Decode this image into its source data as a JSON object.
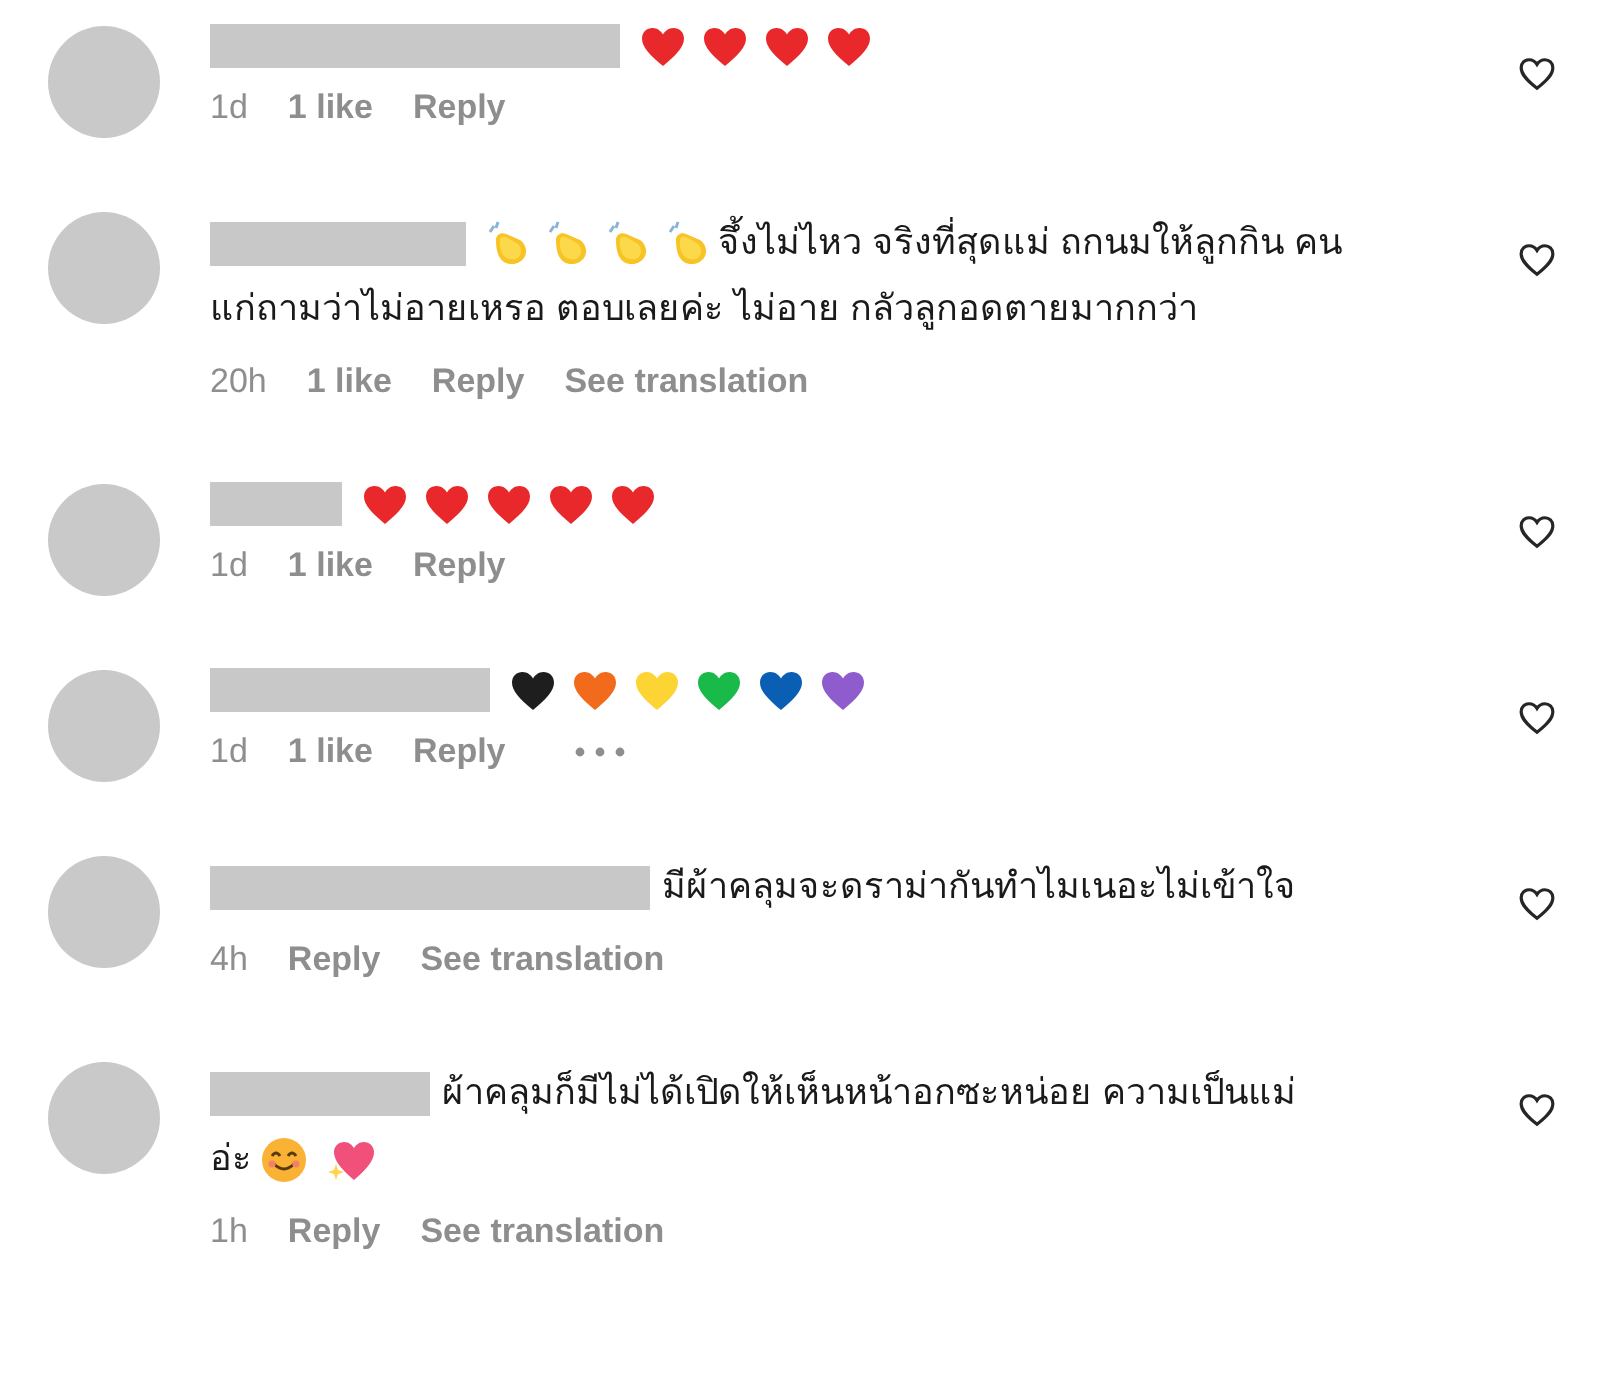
{
  "comments": [
    {
      "lines": [
        [
          {
            "kind": "heart",
            "color": "#e8282b"
          },
          {
            "kind": "heart",
            "color": "#e8282b"
          },
          {
            "kind": "heart",
            "color": "#e8282b"
          },
          {
            "kind": "heart",
            "color": "#e8282b"
          }
        ]
      ],
      "meta": [
        {
          "kind": "time",
          "text": "1d"
        },
        {
          "kind": "likes",
          "text": "1 like"
        },
        {
          "kind": "reply",
          "text": "Reply"
        }
      ],
      "liked": false
    },
    {
      "lines": [
        [
          {
            "kind": "clap"
          },
          {
            "kind": "clap"
          },
          {
            "kind": "clap"
          },
          {
            "kind": "clap"
          },
          {
            "kind": "text",
            "text": "จึ้งไม่ไหว จริงที่สุดแม่ ถกนมให้ลูกกิน คน"
          }
        ],
        [
          {
            "kind": "text",
            "text": "แก่ถามว่าไม่อายเหรอ ตอบเลยค่ะ ไม่อาย กลัวลูกอดตายมากกว่า"
          }
        ]
      ],
      "meta": [
        {
          "kind": "time",
          "text": "20h"
        },
        {
          "kind": "likes",
          "text": "1 like"
        },
        {
          "kind": "reply",
          "text": "Reply"
        },
        {
          "kind": "translation",
          "text": "See translation"
        }
      ],
      "liked": false
    },
    {
      "lines": [
        [
          {
            "kind": "heart",
            "color": "#e8282b"
          },
          {
            "kind": "heart",
            "color": "#e8282b"
          },
          {
            "kind": "heart",
            "color": "#e8282b"
          },
          {
            "kind": "heart",
            "color": "#e8282b"
          },
          {
            "kind": "heart",
            "color": "#e8282b"
          }
        ]
      ],
      "meta": [
        {
          "kind": "time",
          "text": "1d"
        },
        {
          "kind": "likes",
          "text": "1 like"
        },
        {
          "kind": "reply",
          "text": "Reply"
        }
      ],
      "liked": false
    },
    {
      "lines": [
        [
          {
            "kind": "heart",
            "color": "#1e1e1e"
          },
          {
            "kind": "heart",
            "color": "#f26b1d"
          },
          {
            "kind": "heart",
            "color": "#fcd535"
          },
          {
            "kind": "heart",
            "color": "#19b94a"
          },
          {
            "kind": "heart",
            "color": "#0a5fb4"
          },
          {
            "kind": "heart",
            "color": "#8e5ccc"
          }
        ]
      ],
      "meta": [
        {
          "kind": "time",
          "text": "1d"
        },
        {
          "kind": "likes",
          "text": "1 like"
        },
        {
          "kind": "reply",
          "text": "Reply"
        },
        {
          "kind": "more"
        }
      ],
      "liked": false
    },
    {
      "lines": [
        [
          {
            "kind": "text",
            "text": "มีผ้าคลุมจะดราม่ากันทำไมเนอะไม่เข้าใจ"
          }
        ]
      ],
      "meta": [
        {
          "kind": "time",
          "text": "4h"
        },
        {
          "kind": "reply",
          "text": "Reply"
        },
        {
          "kind": "translation",
          "text": "See translation"
        }
      ],
      "liked": false
    },
    {
      "lines": [
        [
          {
            "kind": "text",
            "text": "ผ้าคลุมก็มีไม่ได้เปิดให้เห็นหน้าอกซะหน่อย ความเป็นแม่"
          }
        ],
        [
          {
            "kind": "text",
            "text": "อ่ะ"
          },
          {
            "kind": "smile"
          },
          {
            "kind": "sparkle_heart"
          }
        ]
      ],
      "meta": [
        {
          "kind": "time",
          "text": "1h"
        },
        {
          "kind": "reply",
          "text": "Reply"
        },
        {
          "kind": "translation",
          "text": "See translation"
        }
      ],
      "liked": false
    }
  ]
}
